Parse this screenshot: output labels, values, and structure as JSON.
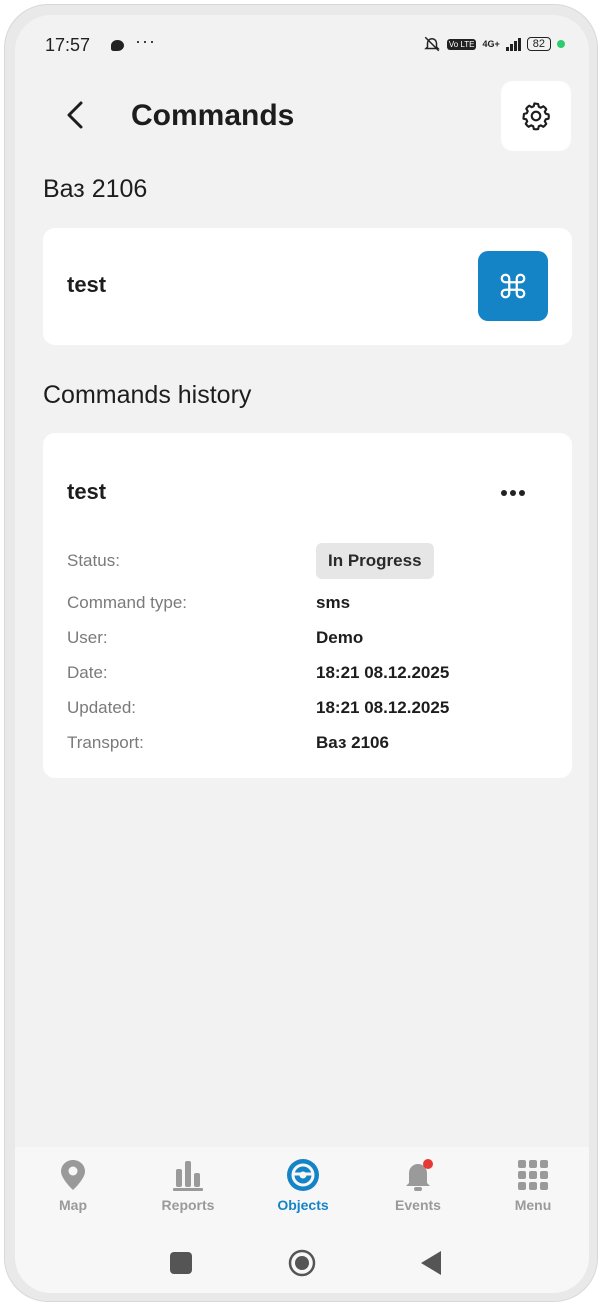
{
  "status_bar": {
    "time": "17:57",
    "dots": "···",
    "network": "4G+",
    "volte": "Vo LTE",
    "battery": "82",
    "battery_dot_color": "#2ecc71"
  },
  "header": {
    "title": "Commands",
    "back_icon": "chevron-left-icon",
    "settings_icon": "gear-icon"
  },
  "object_name": "Ваз 2106",
  "command": {
    "name": "test",
    "send_icon": "command-key-icon",
    "accent": "#1584c7"
  },
  "history": {
    "title": "Commands history",
    "items": [
      {
        "name": "test",
        "more_icon": "more-horizontal-icon",
        "rows": {
          "status_label": "Status:",
          "status_value": "In Progress",
          "type_label": "Command type:",
          "type_value": "sms",
          "user_label": "User:",
          "user_value": "Demo",
          "date_label": "Date:",
          "date_value": "18:21 08.12.2025",
          "updated_label": "Updated:",
          "updated_value": "18:21 08.12.2025",
          "transport_label": "Transport:",
          "transport_value": "Ваз 2106"
        }
      }
    ]
  },
  "bottom_nav": {
    "items": [
      {
        "label": "Map",
        "icon": "map-pin-icon"
      },
      {
        "label": "Reports",
        "icon": "bar-chart-icon"
      },
      {
        "label": "Objects",
        "icon": "steering-wheel-icon",
        "active": true
      },
      {
        "label": "Events",
        "icon": "bell-icon"
      },
      {
        "label": "Menu",
        "icon": "grid-icon"
      }
    ],
    "active_color": "#1584c7",
    "inactive_color": "#9a9a9a"
  }
}
